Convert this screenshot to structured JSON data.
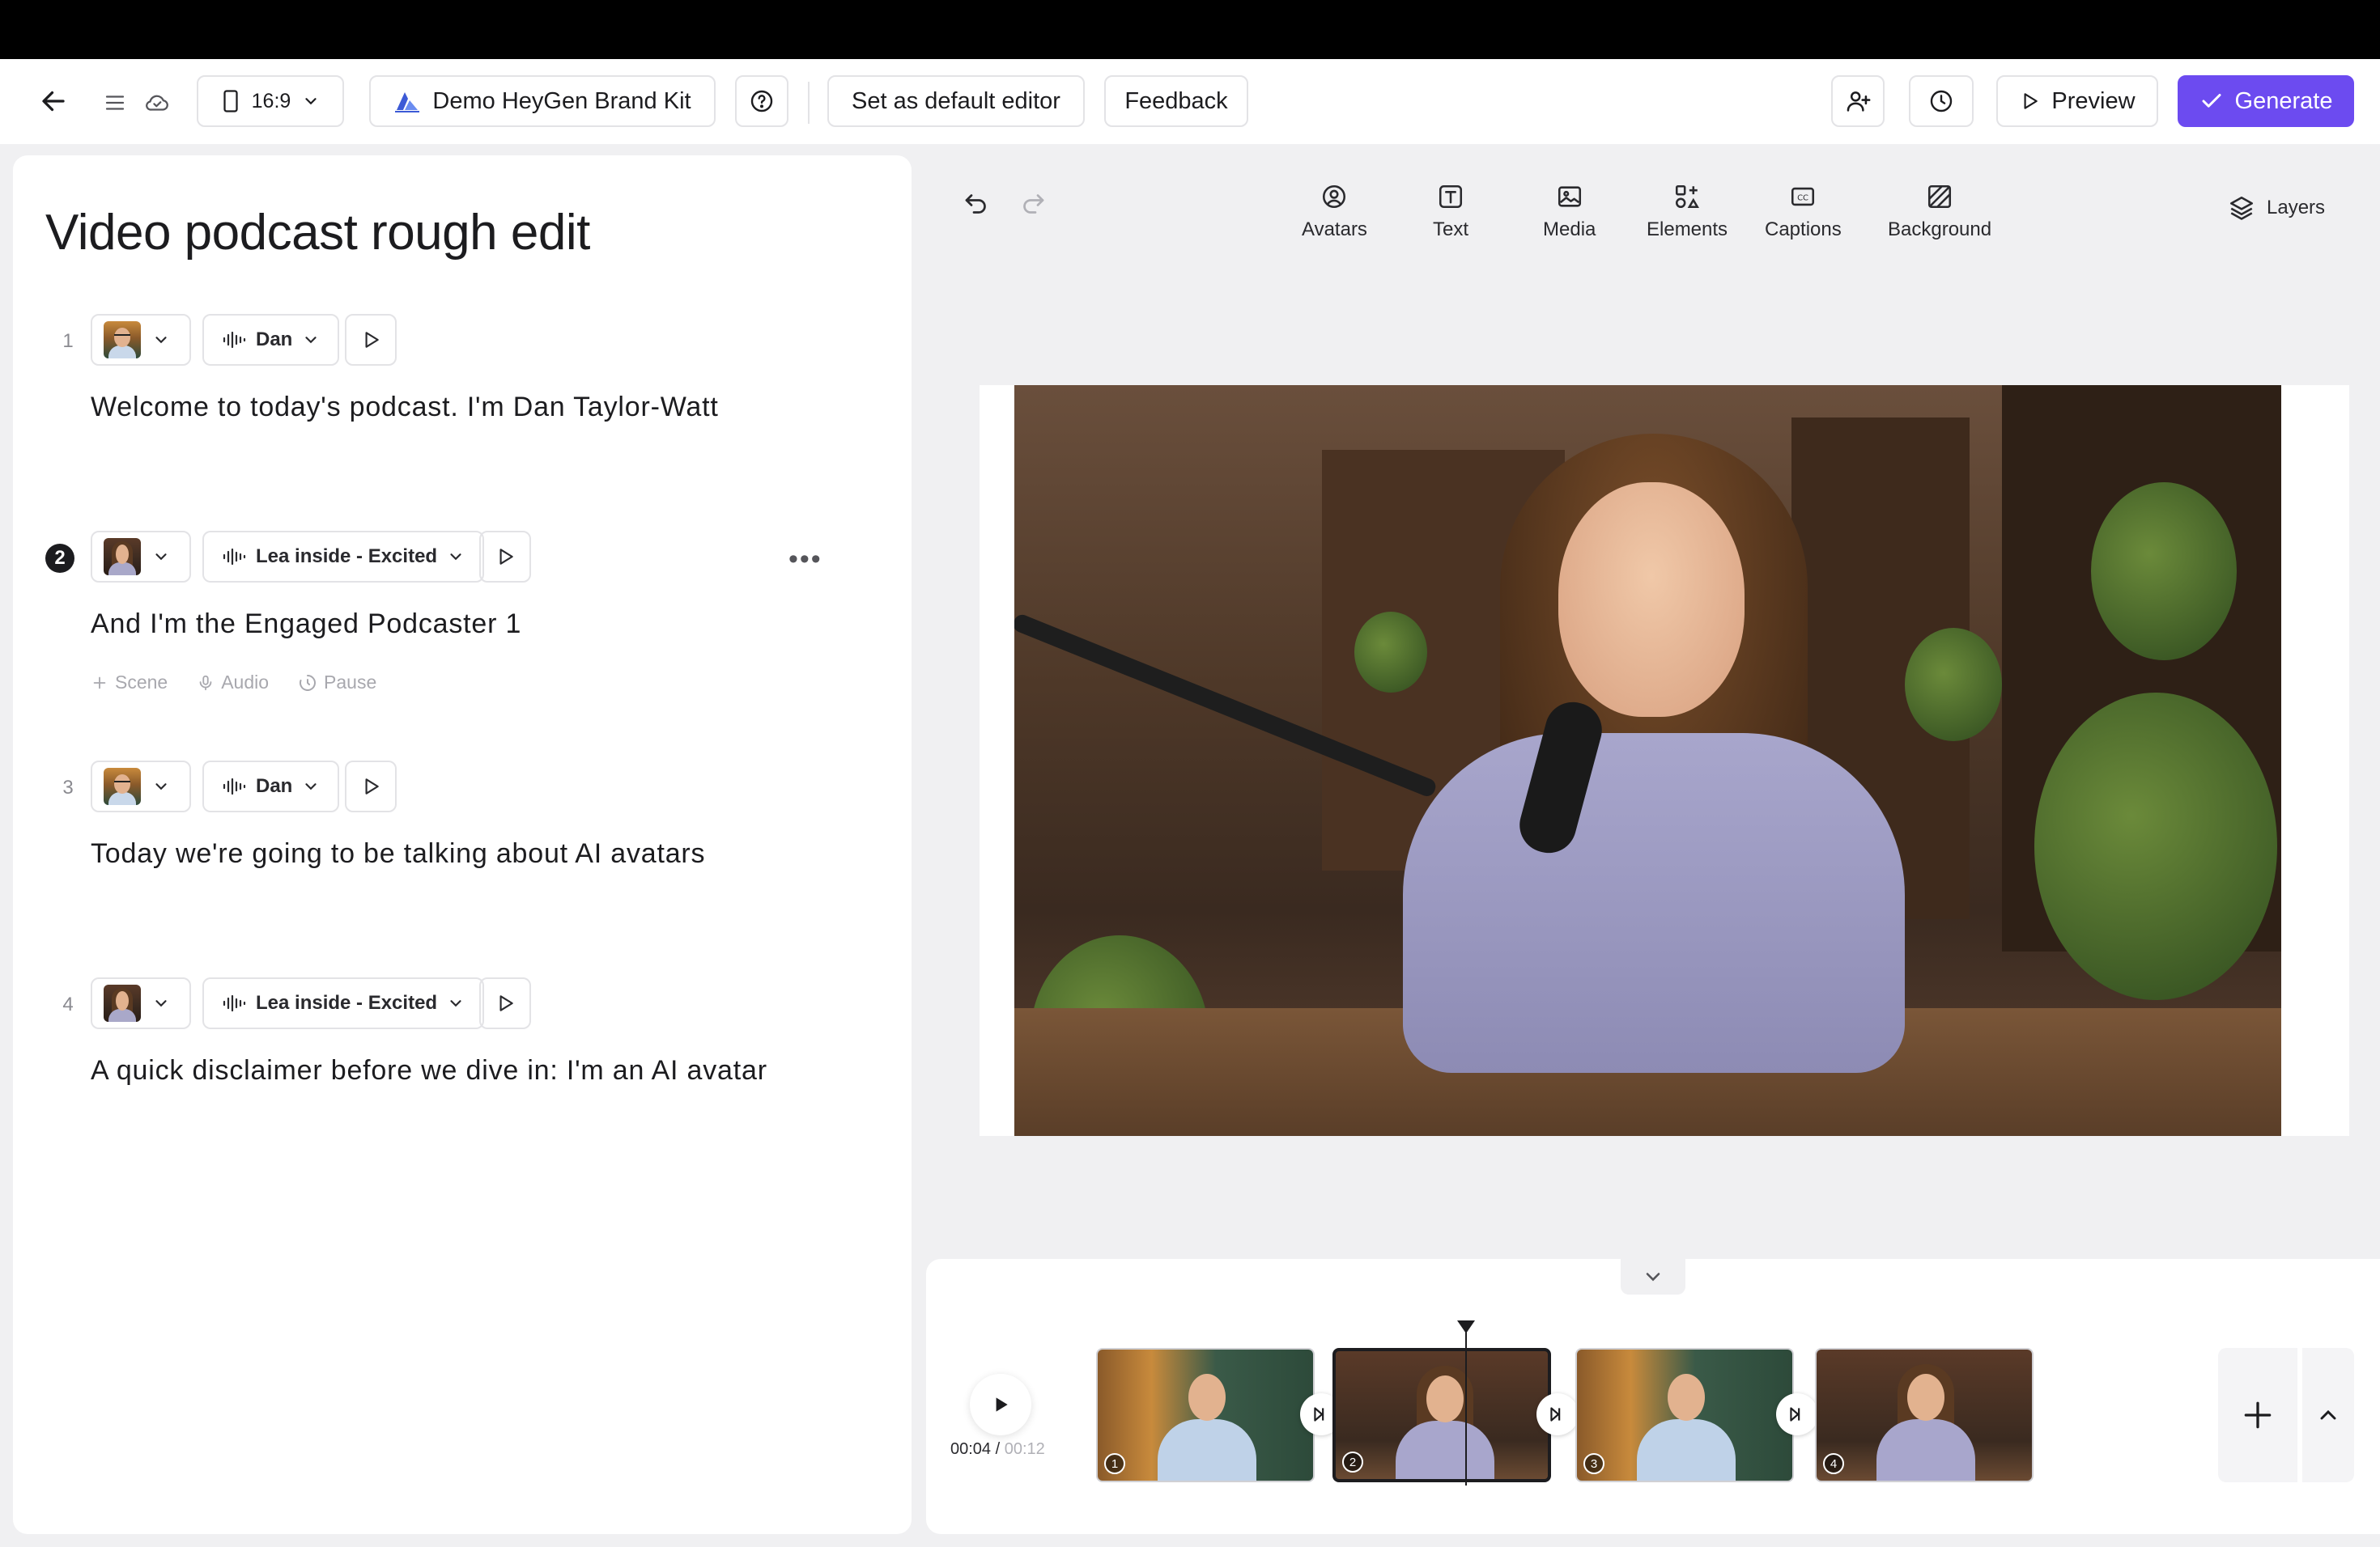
{
  "header": {
    "aspect_ratio": "16:9",
    "brand_kit": "Demo HeyGen Brand Kit",
    "set_default_label": "Set as default editor",
    "feedback_label": "Feedback",
    "preview_label": "Preview",
    "generate_label": "Generate",
    "accent_color": "#6c4bf0"
  },
  "script": {
    "title": "Video podcast rough edit",
    "scenes": [
      {
        "number": "1",
        "voice": "Dan",
        "avatar": "dan",
        "text": "Welcome to today's podcast. I'm Dan Taylor-Watt"
      },
      {
        "number": "2",
        "voice": "Lea inside - Excited",
        "avatar": "lea",
        "text": "And I'm the Engaged Podcaster 1",
        "active": true
      },
      {
        "number": "3",
        "voice": "Dan",
        "avatar": "dan",
        "text": "Today we're going to be talking about AI avatars"
      },
      {
        "number": "4",
        "voice": "Lea inside - Excited",
        "avatar": "lea",
        "text": "A quick disclaimer before we dive in: I'm an AI avatar"
      }
    ],
    "scene_actions": {
      "scene": "Scene",
      "audio": "Audio",
      "pause": "Pause"
    }
  },
  "canvas_tools": {
    "avatars": "Avatars",
    "text": "Text",
    "media": "Media",
    "elements": "Elements",
    "captions": "Captions",
    "background": "Background",
    "layers": "Layers"
  },
  "timeline": {
    "current_time": "00:04",
    "separator": " / ",
    "total_time": "00:12",
    "clips": [
      "1",
      "2",
      "3",
      "4"
    ]
  }
}
